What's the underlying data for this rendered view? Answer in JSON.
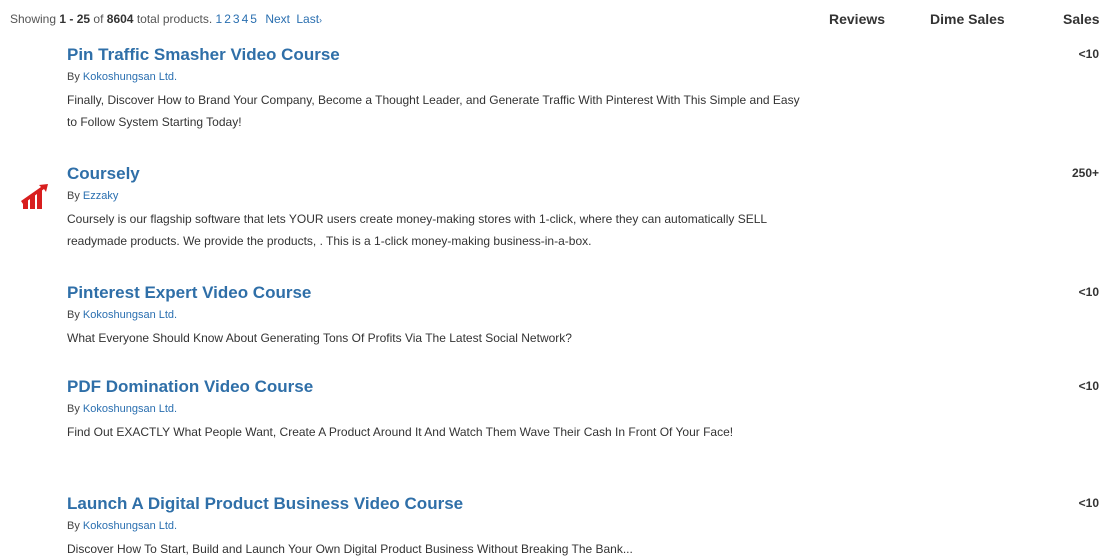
{
  "summary": {
    "prefix": "Showing",
    "range": "1 - 25",
    "of": "of",
    "total": "8604",
    "suffix": "total products."
  },
  "pagination": {
    "pages": [
      "1",
      "2",
      "3",
      "4",
      "5"
    ],
    "current": "1",
    "next_label": "Next",
    "last_label": "Last",
    "last_chevron": "›"
  },
  "columns": {
    "reviews": "Reviews",
    "dime_sales": "Dime Sales",
    "sales": "Sales"
  },
  "by_label": "By",
  "products": [
    {
      "title": "Pin Traffic Smasher Video Course",
      "vendor": "Kokoshungsan Ltd.",
      "description": "Finally, Discover How to Brand Your Company, Become a Thought Leader, and Generate Traffic With Pinterest With This Simple and Easy to Follow System Starting Today!",
      "sales": "<10",
      "logo_icon": ""
    },
    {
      "title": "Coursely",
      "vendor": "Ezzaky",
      "description": "Coursely is our flagship software that lets YOUR users create money-making stores with 1-click, where they can automatically SELL readymade products. We provide the products, . This is a 1-click money-making business-in-a-box.",
      "sales": "250+",
      "logo_icon": "coursely-logo-icon"
    },
    {
      "title": "Pinterest Expert Video Course",
      "vendor": "Kokoshungsan Ltd.",
      "description": "What Everyone Should Know About Generating Tons Of Profits Via The Latest Social Network?",
      "sales": "<10",
      "logo_icon": ""
    },
    {
      "title": "PDF Domination Video Course",
      "vendor": "Kokoshungsan Ltd.",
      "description": "Find Out EXACTLY What People Want, Create A Product Around It And Watch Them Wave Their Cash In Front Of Your Face!",
      "sales": "<10",
      "logo_icon": ""
    },
    {
      "title": "Launch A Digital Product Business Video Course",
      "vendor": "Kokoshungsan Ltd.",
      "description": "Discover How To Start, Build and Launch Your Own Digital Product Business Without Breaking The Bank...",
      "sales": "<10",
      "logo_icon": ""
    }
  ],
  "colors": {
    "title_link": "#2f6fa8",
    "vendor_link": "#2a6fb0",
    "body_text": "#333333",
    "logo_red": "#d81e1e"
  }
}
